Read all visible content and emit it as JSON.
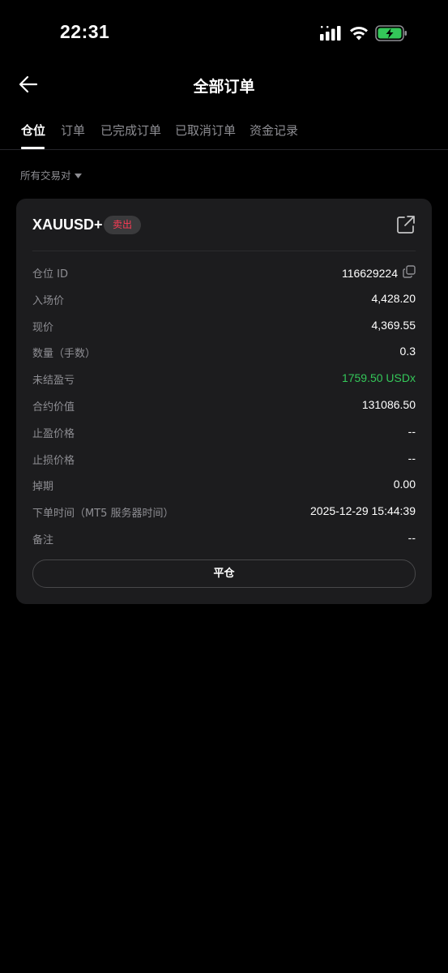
{
  "status_bar": {
    "time": "22:31"
  },
  "header": {
    "title": "全部订单"
  },
  "tabs": [
    {
      "label": "仓位",
      "active": true
    },
    {
      "label": "订单",
      "active": false
    },
    {
      "label": "已完成订单",
      "active": false
    },
    {
      "label": "已取消订单",
      "active": false
    },
    {
      "label": "资金记录",
      "active": false
    }
  ],
  "filter": {
    "label": "所有交易对"
  },
  "position": {
    "symbol": "XAUUSD+",
    "side": "卖出",
    "rows": [
      {
        "label": "仓位 ID",
        "value": "116629224"
      },
      {
        "label": "入场价",
        "value": "4,428.20"
      },
      {
        "label": "现价",
        "value": "4,369.55"
      },
      {
        "label": "数量（手数）",
        "value": "0.3"
      },
      {
        "label": "未结盈亏",
        "value": "1759.50 USDx"
      },
      {
        "label": "合约价值",
        "value": "131086.50"
      },
      {
        "label": "止盈价格",
        "value": "--"
      },
      {
        "label": "止损价格",
        "value": "--"
      },
      {
        "label": "掉期",
        "value": "0.00"
      },
      {
        "label": "下单时间（MT5 服务器时间）",
        "value": "2025-12-29 15:44:39"
      },
      {
        "label": "备注",
        "value": "--"
      }
    ],
    "close_label": "平仓"
  },
  "colors": {
    "background": "#000000",
    "card": "#1c1c1e",
    "sell": "#ff3b55",
    "profit": "#34c759",
    "battery": "#34c759"
  }
}
